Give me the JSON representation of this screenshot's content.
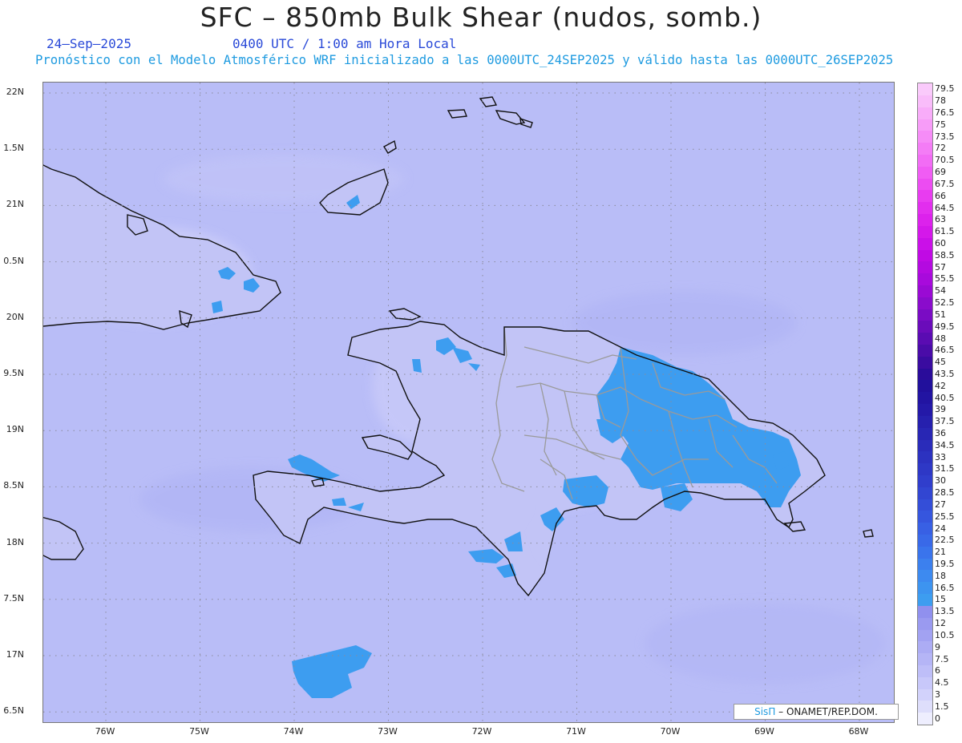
{
  "title": "SFC – 850mb Bulk Shear (nudos, somb.)",
  "date": "24–Sep–2025",
  "utc_time": "0400 UTC / 1:00 am Hora Local",
  "subtitle": "Pronóstico con el Modelo Atmosférico WRF inicializado a las 0000UTC_24SEP2025 y válido hasta las  0000UTC_26SEP2025",
  "axes": {
    "lat_labels": [
      "22N",
      "1.5N",
      "21N",
      "0.5N",
      "20N",
      "9.5N",
      "19N",
      "8.5N",
      "18N",
      "7.5N",
      "17N",
      "6.5N"
    ],
    "lon_labels": [
      "76W",
      "75W",
      "74W",
      "73W",
      "72W",
      "71W",
      "70W",
      "69W",
      "68W"
    ]
  },
  "legend": {
    "levels": [
      "0",
      "1.5",
      "3",
      "4.5",
      "6",
      "7.5",
      "9",
      "10.5",
      "12",
      "13.5",
      "15",
      "16.5",
      "18",
      "19.5",
      "21",
      "22.5",
      "24",
      "25.5",
      "27",
      "28.5",
      "30",
      "31.5",
      "33",
      "34.5",
      "36",
      "37.5",
      "39",
      "40.5",
      "42",
      "43.5",
      "45",
      "46.5",
      "48",
      "49.5",
      "51",
      "52.5",
      "54",
      "55.5",
      "57",
      "58.5",
      "60",
      "61.5",
      "63",
      "64.5",
      "66",
      "67.5",
      "69",
      "70.5",
      "72",
      "73.5",
      "75",
      "76.5",
      "78",
      "79.5"
    ],
    "colors": [
      "#eeeefe",
      "#dedefb",
      "#d2d2fb",
      "#c8c8fa",
      "#bebef8",
      "#b5b5f6",
      "#acacf4",
      "#a2a2f2",
      "#9a9af0",
      "#9090ee",
      "#3d9df0",
      "#3d94f0",
      "#3d8af0",
      "#3c80ee",
      "#3a74ec",
      "#3969e8",
      "#3860e4",
      "#3656de",
      "#344ed8",
      "#3246d2",
      "#303ecc",
      "#2e38c6",
      "#2c32c0",
      "#2a2cba",
      "#2826b4",
      "#2620ae",
      "#2419a8",
      "#2214a2",
      "#21109c",
      "#2a0c9a",
      "#3a0ca0",
      "#4a0ca8",
      "#5a0cb2",
      "#6a0cba",
      "#7a0cc4",
      "#8a0ccc",
      "#9a0ad4",
      "#a80adc",
      "#b40ae0",
      "#c00ae4",
      "#ca10e8",
      "#d418ea",
      "#dc22ec",
      "#e22eee",
      "#e83cf0",
      "#ec4cf2",
      "#f05cf4",
      "#f26cf5",
      "#f47cf6",
      "#f68cf7",
      "#f79cf8",
      "#f8acf9",
      "#f9bcfa",
      "#facafb"
    ],
    "water_color": "#b9bdf7",
    "land_color": "#c2c4f6",
    "shear_color": "#3d9df0"
  },
  "credit": {
    "brand": "SisΠ",
    "org": "– ONAMET/REP.DOM."
  }
}
